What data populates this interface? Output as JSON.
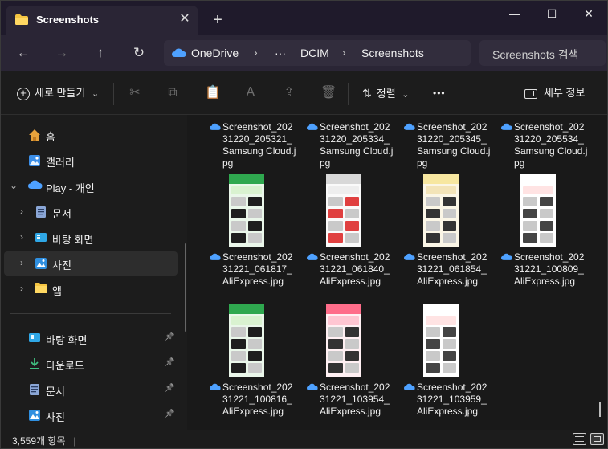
{
  "window": {
    "tab_title": "Screenshots",
    "tab_close": "✕",
    "new_tab": "+",
    "minimize": "—",
    "maximize": "☐",
    "close": "✕"
  },
  "nav": {
    "back": "←",
    "forward": "→",
    "up": "↑",
    "refresh": "↻",
    "breadcrumb": [
      "OneDrive",
      "DCIM",
      "Screenshots"
    ],
    "ellipsis": "···",
    "sep": "›",
    "search_placeholder": "Screenshots 검색"
  },
  "commands": {
    "new_label": "새로 만들기",
    "new_chevron": "⌄",
    "sort_label": "정렬",
    "sort_chevron": "⌄",
    "more": "•••",
    "details_label": "세부 정보"
  },
  "sidebar": {
    "items": [
      {
        "label": "홈",
        "icon": "home-icon"
      },
      {
        "label": "갤러리",
        "icon": "gallery-icon"
      },
      {
        "label": "Play - 개인",
        "icon": "onedrive-icon",
        "chevron": "⌄"
      },
      {
        "label": "문서",
        "icon": "documents-icon",
        "chevron": "›"
      },
      {
        "label": "바탕 화면",
        "icon": "desktop-icon",
        "chevron": "›"
      },
      {
        "label": "사진",
        "icon": "pictures-icon",
        "chevron": "›",
        "selected": true
      },
      {
        "label": "앱",
        "icon": "folder-icon",
        "chevron": "›"
      }
    ],
    "pinned": [
      {
        "label": "바탕 화면",
        "icon": "desktop-icon"
      },
      {
        "label": "다운로드",
        "icon": "download-icon"
      },
      {
        "label": "문서",
        "icon": "documents-icon"
      },
      {
        "label": "사진",
        "icon": "pictures-icon"
      }
    ],
    "pin_glyph": "📌"
  },
  "files": [
    {
      "name": "Screenshot_20231220_205321_Samsung Cloud.jpg",
      "thumb": false
    },
    {
      "name": "Screenshot_20231220_205334_Samsung Cloud.jpg",
      "thumb": false
    },
    {
      "name": "Screenshot_20231220_205345_Samsung Cloud.jpg",
      "thumb": false
    },
    {
      "name": "Screenshot_20231220_205534_Samsung Cloud.jpg",
      "thumb": false
    },
    {
      "name": "Screenshot_20231221_061817_AliExpress.jpg",
      "thumb": true,
      "theme": "green"
    },
    {
      "name": "Screenshot_20231221_061840_AliExpress.jpg",
      "thumb": true,
      "theme": "gray"
    },
    {
      "name": "Screenshot_20231221_061854_AliExpress.jpg",
      "thumb": true,
      "theme": "yellow"
    },
    {
      "name": "Screenshot_20231221_100809_AliExpress.jpg",
      "thumb": true,
      "theme": "white"
    },
    {
      "name": "Screenshot_20231221_100816_AliExpress.jpg",
      "thumb": true,
      "theme": "green"
    },
    {
      "name": "Screenshot_20231221_103954_AliExpress.jpg",
      "thumb": true,
      "theme": "pink"
    },
    {
      "name": "Screenshot_20231221_103959_AliExpress.jpg",
      "thumb": true,
      "theme": "white"
    }
  ],
  "status": {
    "item_count": "3,559개 항목",
    "cursor": "|"
  },
  "colors": {
    "titlebar": "#1f1a2b",
    "navbar": "#2a2535",
    "accent_onedrive": "#4ea1ff",
    "folder_yellow": "#f5c542"
  }
}
